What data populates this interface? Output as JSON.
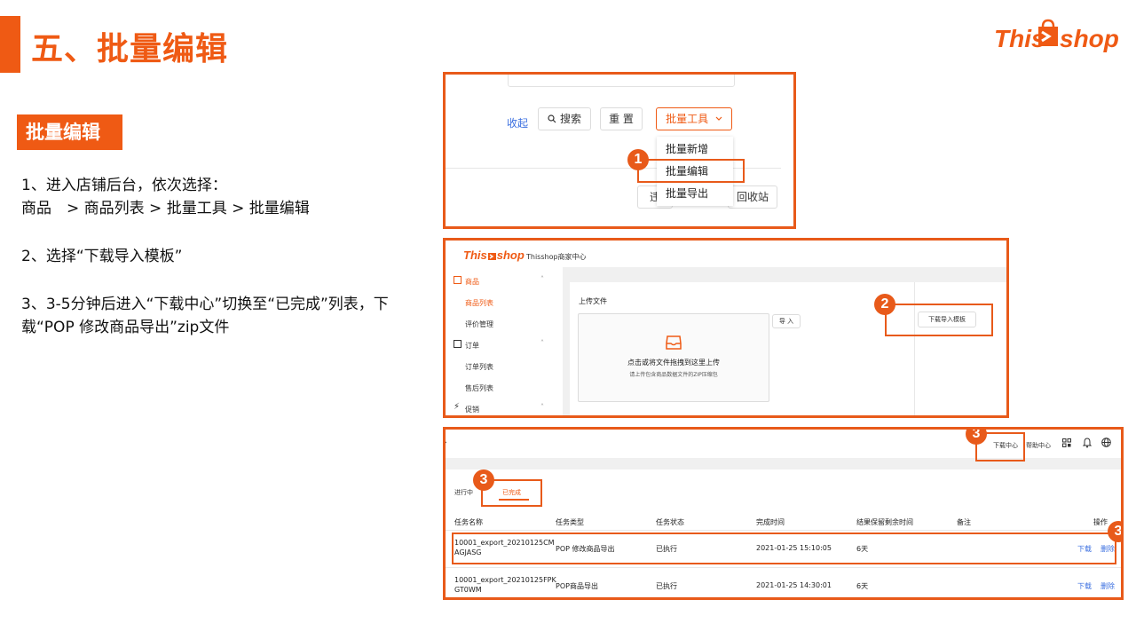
{
  "slide": {
    "title": "五、批量编辑",
    "logo": {
      "this": "This",
      "shop": "shop"
    },
    "section_tag": "批量编辑",
    "steps": [
      "1、进入店铺后台，依次选择：",
      "商品　> 商品列表 > 批量工具 > 批量编辑",
      "2、选择“下载导入模板”",
      "3、3-5分钟后进入“下载中心”切换至“已完成”列表，下载“POP 修改商品导出”zip文件"
    ]
  },
  "panel1": {
    "collapse_link": "收起",
    "search_button": "搜索",
    "reset_button": "重 置",
    "batch_tools_button": "批量工具",
    "menu_items": [
      "批量新增",
      "批量编辑",
      "批量导出"
    ],
    "partial_button_left": "违",
    "recycle_button": "回收站",
    "badge": "1"
  },
  "panel2": {
    "logo_this": "This",
    "logo_shop": "shop",
    "merchant_center": "Thisshop商家中心",
    "sidebar": [
      {
        "label": "商品",
        "group": true,
        "icon": "goods-icon"
      },
      {
        "label": "商品列表",
        "active": true
      },
      {
        "label": "评价管理"
      },
      {
        "label": "订单",
        "group": true,
        "icon": "order-icon"
      },
      {
        "label": "订单列表"
      },
      {
        "label": "售后列表"
      },
      {
        "label": "促销",
        "group": true,
        "icon": "promo-icon"
      }
    ],
    "upload_title": "上传文件",
    "upload_main": "点击或将文件拖拽到这里上传",
    "upload_hint": "请上传包含商品数据文件的ZIP压缩包",
    "import_button": "导 入",
    "download_template_button": "下载导入模板",
    "badge": "2"
  },
  "panel3": {
    "top_links": [
      "下载中心",
      "帮助中心"
    ],
    "tabs": [
      "进行中",
      "已完成"
    ],
    "columns": [
      "任务名称",
      "任务类型",
      "任务状态",
      "完成时间",
      "结果保留剩余时间",
      "备注",
      "操作"
    ],
    "rows": [
      {
        "name_line1": "10001_export_20210125CM",
        "name_line2": "AGJASG",
        "type": "POP 修改商品导出",
        "status": "已执行",
        "time": "2021-01-25 15:10:05",
        "remaining": "6天",
        "note": "",
        "actions": [
          "下载",
          "删除"
        ]
      },
      {
        "name_line1": "10001_export_20210125FPK",
        "name_line2": "GT0WM",
        "type": "POP商品导出",
        "status": "已执行",
        "time": "2021-01-25 14:30:01",
        "remaining": "6天",
        "note": "",
        "actions": [
          "下载",
          "删除"
        ]
      }
    ],
    "badge": "3"
  }
}
